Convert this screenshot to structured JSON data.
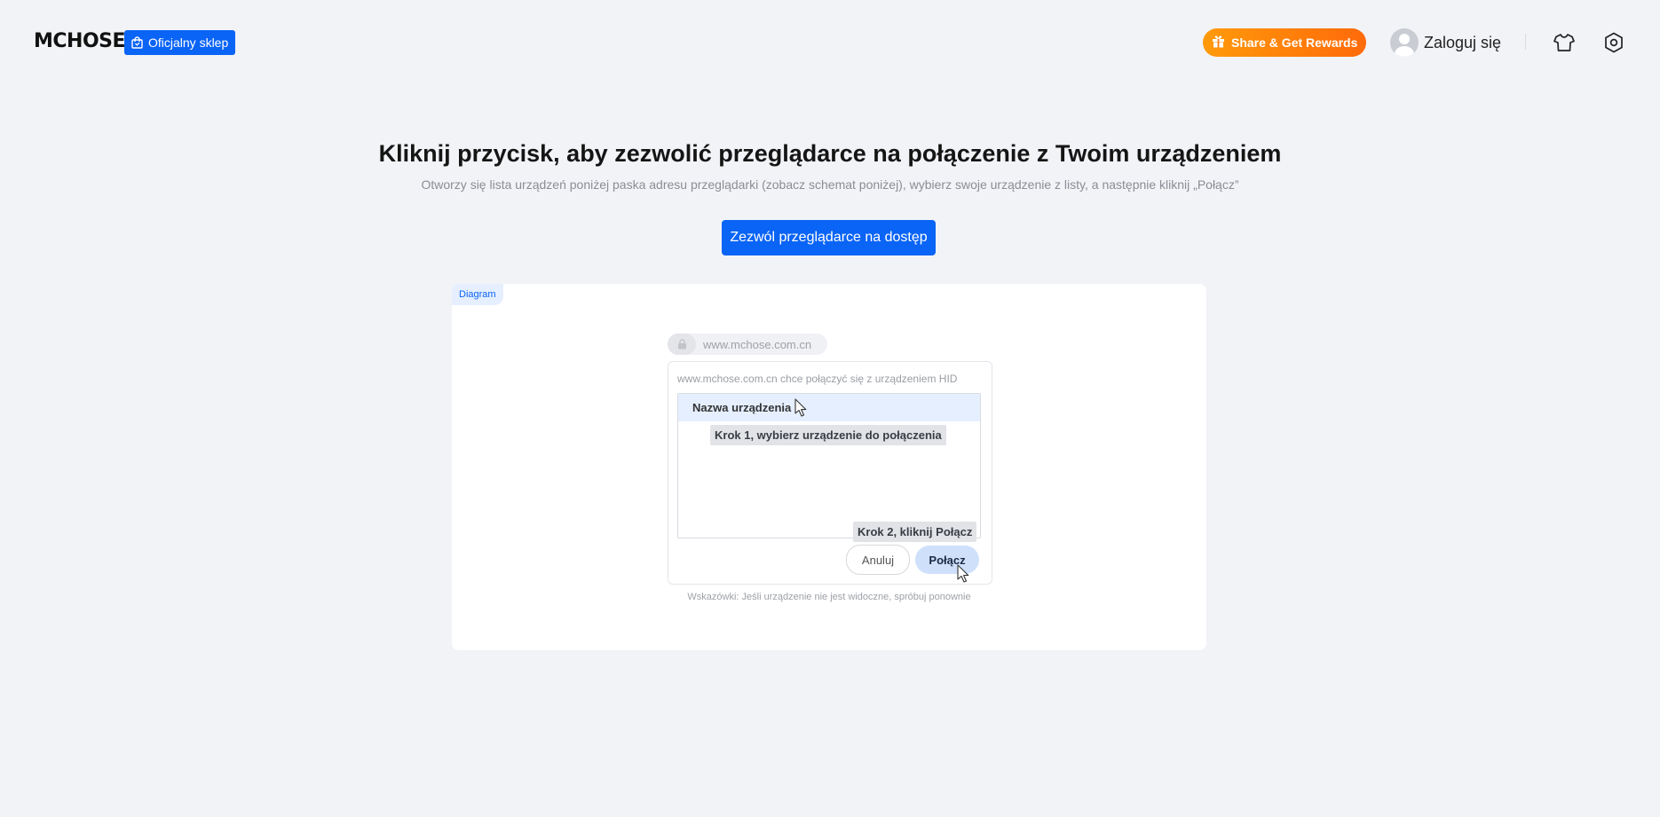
{
  "header": {
    "logo": "MCHOSE",
    "shop_label": "Oficjalny sklep",
    "share_label": "Share & Get Rewards",
    "login_label": "Zaloguj się",
    "icons": [
      "bag-icon",
      "gift-icon",
      "avatar",
      "tshirt-icon",
      "settings-icon"
    ]
  },
  "main": {
    "title": "Kliknij przycisk, aby zezwolić przeglądarce na połączenie z Twoim urządzeniem",
    "subtitle": "Otworzy się lista urządzeń poniżej paska adresu przeglądarki (zobacz schemat poniżej), wybierz swoje urządzenie z listy, a następnie kliknij „Połącz”",
    "allow_button": "Zezwól przeglądarce na dostęp"
  },
  "diagram": {
    "tag": "Diagram",
    "url": "www.mchose.com.cn",
    "dialog_message": "www.mchose.com.cn chce połączyć się z urządzeniem HID",
    "device_name": "Nazwa urządzenia",
    "step1": "Krok 1, wybierz urządzenie do połączenia",
    "step2": "Krok 2, kliknij Połącz",
    "cancel": "Anuluj",
    "connect": "Połącz",
    "tip": "Wskazówki: Jeśli urządzenie nie jest widoczne, spróbuj ponownie"
  },
  "colors": {
    "accent": "#0a64f5",
    "share_gradient_start": "#ff9a0a",
    "share_gradient_end": "#ff6a0a",
    "background": "#f2f3f7"
  }
}
